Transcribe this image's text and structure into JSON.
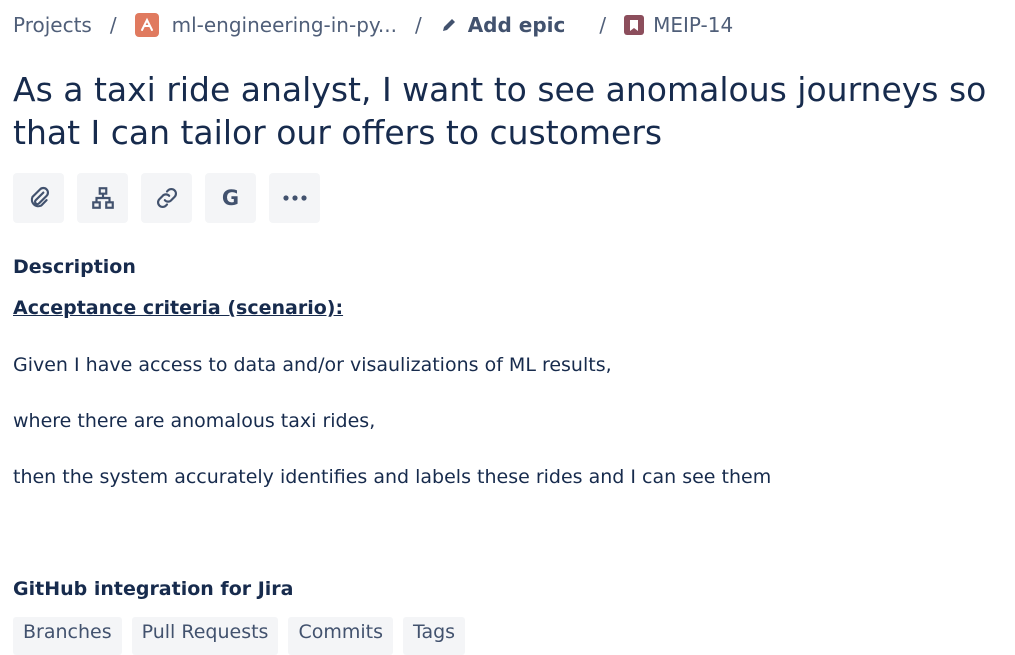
{
  "breadcrumb": {
    "projects": "Projects",
    "separator": "/",
    "project": "ml-engineering-in-py...",
    "add_epic": "Add epic",
    "issue_key": "MEIP-14"
  },
  "issue": {
    "title": "As a taxi ride analyst, I want to see anomalous journeys so that I can tailor our offers to customers"
  },
  "toolbar": {
    "icons": [
      "attachment-icon",
      "child-issue-icon",
      "link-icon",
      "google-icon",
      "more-icon"
    ],
    "g_label": "G"
  },
  "description": {
    "heading": "Description",
    "criteria_heading": "Acceptance criteria (scenario):",
    "paragraphs": [
      "Given I have access to data and/or visaulizations of ML results,",
      "where there are anomalous taxi rides,",
      "then the system accurately identifies and labels these rides and I can see them"
    ]
  },
  "github": {
    "heading": "GitHub integration for Jira",
    "tabs": [
      "Branches",
      "Pull Requests",
      "Commits",
      "Tags"
    ]
  },
  "colors": {
    "text_primary": "#172b4d",
    "text_secondary": "#505f79",
    "button_bg": "#f4f5f7",
    "project_icon": "#e07a5f",
    "issue_icon": "#8c4e5c"
  }
}
